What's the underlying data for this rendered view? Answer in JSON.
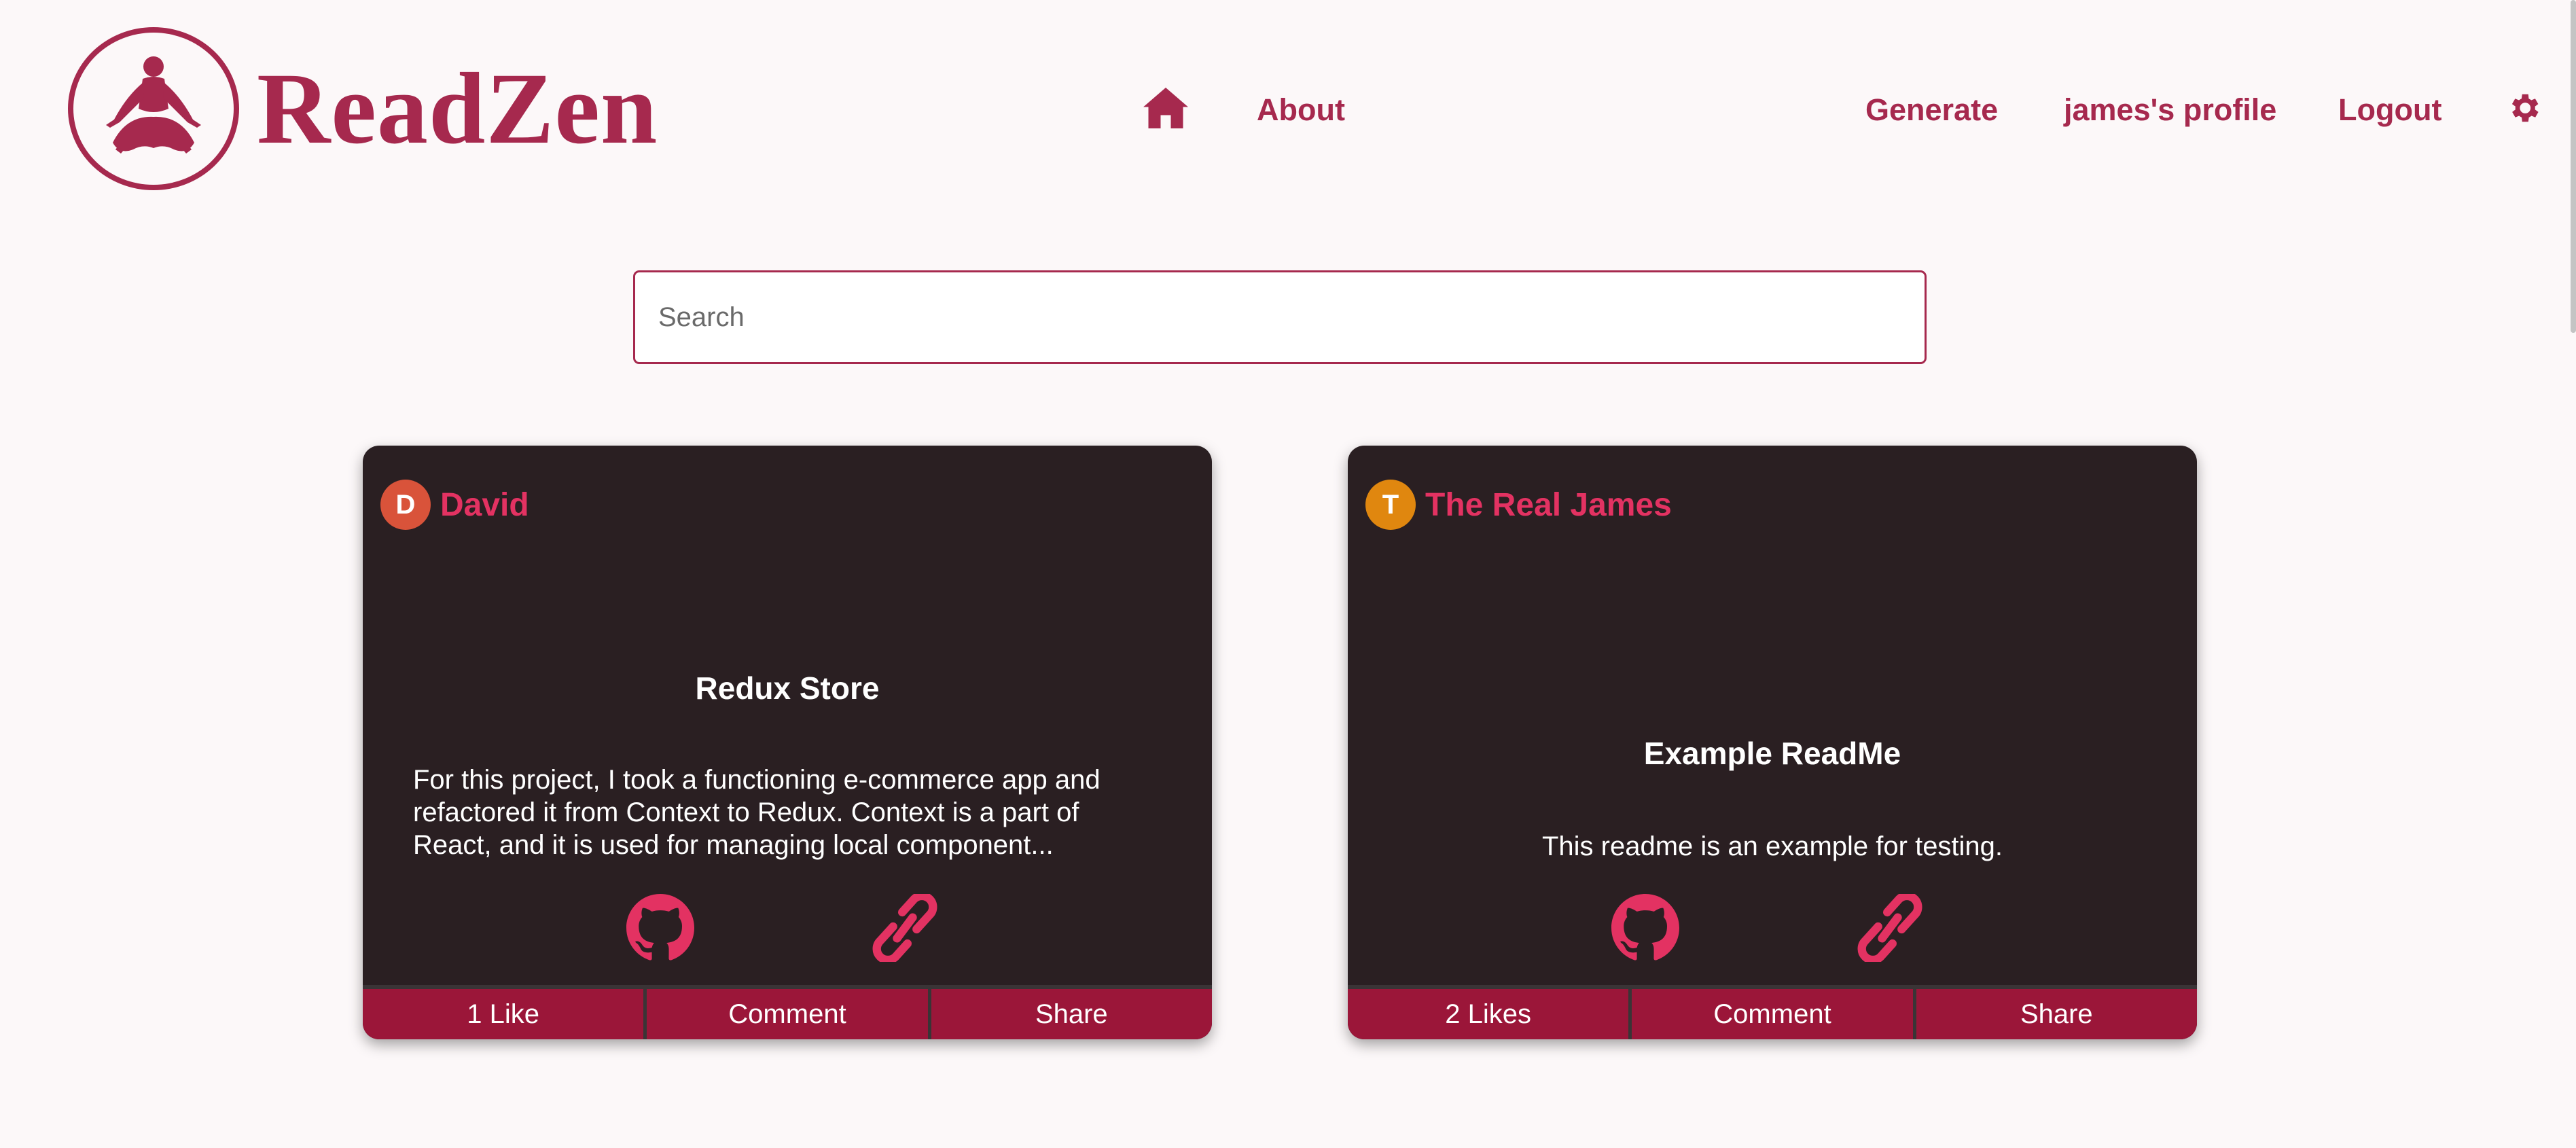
{
  "brand": {
    "name": "ReadZen",
    "accent": "#a6294e"
  },
  "nav": {
    "home_icon": "home-icon",
    "about": "About",
    "generate": "Generate",
    "profile": "james's profile",
    "logout": "Logout",
    "settings_icon": "gear-icon"
  },
  "search": {
    "placeholder": "Search",
    "value": ""
  },
  "cards": [
    {
      "avatar_letter": "D",
      "avatar_color": "#d9533a",
      "author": "David",
      "title": "Redux Store",
      "description": "For this project, I took a functioning e-commerce app and refactored it from Context to Redux. Context is a part of React, and it is used for managing local component...",
      "github_icon": "github-icon",
      "link_icon": "link-icon",
      "actions": {
        "like": "1 Like",
        "comment": "Comment",
        "share": "Share"
      }
    },
    {
      "avatar_letter": "T",
      "avatar_color": "#e0870f",
      "author": "The Real James",
      "title": "Example ReadMe",
      "description": "This readme is an example for testing.",
      "github_icon": "github-icon",
      "link_icon": "link-icon",
      "actions": {
        "like": "2 Likes",
        "comment": "Comment",
        "share": "Share"
      }
    }
  ]
}
